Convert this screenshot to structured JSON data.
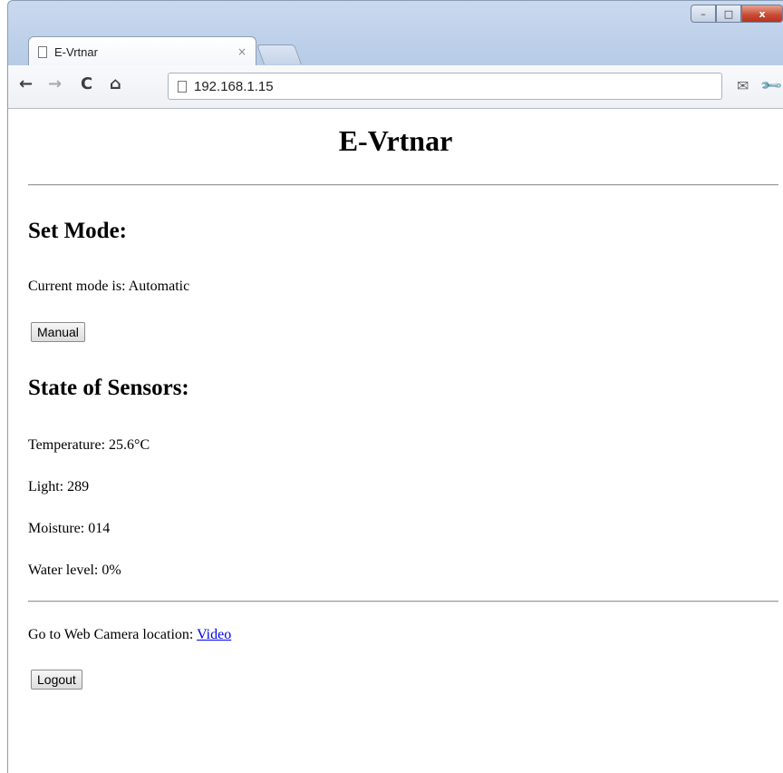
{
  "browser": {
    "tab_title": "E-Vrtnar",
    "tab_close": "×",
    "url": "192.168.1.15",
    "window_controls": {
      "minimize": "–",
      "maximize": "□",
      "close": "x"
    },
    "nav": {
      "back": "←",
      "forward": "→",
      "reload": "C",
      "home": "⌂"
    },
    "toolbar_icons": [
      "mail-icon",
      "wrench-icon"
    ]
  },
  "page": {
    "title": "E-Vrtnar",
    "mode_heading": "Set Mode:",
    "current_mode": "Current mode is: Automatic",
    "mode_button": "Manual",
    "sensors_heading": "State of Sensors:",
    "sensors": [
      {
        "label": "Temperature: 25.6°C"
      },
      {
        "label": "Light: 289"
      },
      {
        "label": "Moisture: 014"
      },
      {
        "label": "Water level: 0%"
      }
    ],
    "camera_text": "Go to Web Camera location: ",
    "camera_link": "Video",
    "logout_button": "Logout"
  }
}
